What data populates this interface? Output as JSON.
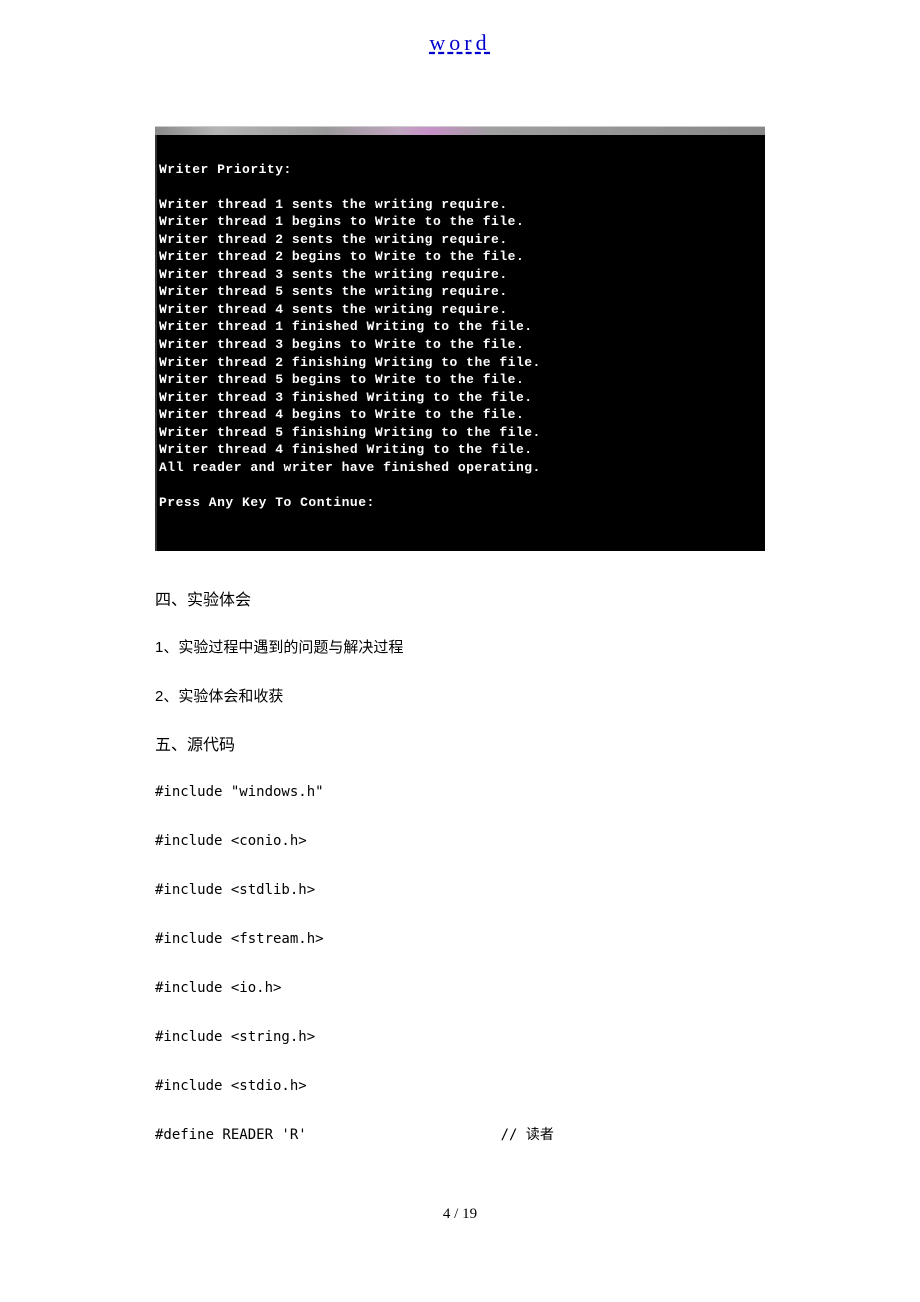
{
  "header": {
    "link_text": "word"
  },
  "terminal": {
    "lines": [
      "Writer Priority:",
      "",
      "Writer thread 1 sents the writing require.",
      "Writer thread 1 begins to Write to the file.",
      "Writer thread 2 sents the writing require.",
      "Writer thread 2 begins to Write to the file.",
      "Writer thread 3 sents the writing require.",
      "Writer thread 5 sents the writing require.",
      "Writer thread 4 sents the writing require.",
      "Writer thread 1 finished Writing to the file.",
      "Writer thread 3 begins to Write to the file.",
      "Writer thread 2 finishing Writing to the file.",
      "Writer thread 5 begins to Write to the file.",
      "Writer thread 3 finished Writing to the file.",
      "Writer thread 4 begins to Write to the file.",
      "Writer thread 5 finishing Writing to the file.",
      "Writer thread 4 finished Writing to the file.",
      "All reader and writer have finished operating.",
      "",
      "Press Any Key To Continue:"
    ]
  },
  "doc": {
    "heading4": "四、实验体会",
    "para1": "1、实验过程中遇到的问题与解决过程",
    "para2": "2、实验体会和收获",
    "heading5": "五、源代码",
    "code": [
      "#include \"windows.h\"",
      "#include <conio.h>",
      "#include <stdlib.h>",
      "#include <fstream.h>",
      "#include <io.h>",
      "#include <string.h>",
      "#include <stdio.h>",
      "",
      "#define READER 'R'                       // 读者"
    ]
  },
  "footer": {
    "pagenum": "4 / 19"
  }
}
